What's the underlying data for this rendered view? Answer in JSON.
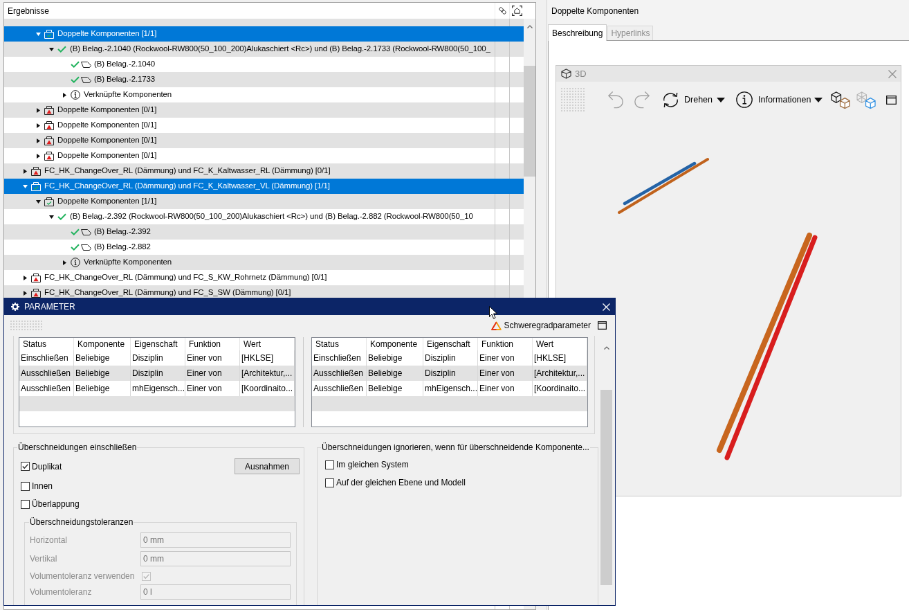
{
  "results_panel": {
    "title": "Ergebnisse",
    "tree": [
      {
        "children": [
          {
            "kind": "group",
            "resolved": true,
            "label": "Doppelte Komponenten [1/1]",
            "selected": true,
            "expanded": true,
            "children": [
              {
                "kind": "pair",
                "label": "(B) Belag.-2.1040 (Rockwool-RW800(50_100_200)Alukaschiert <Rc>) und (B) Belag.-2.1733 (Rockwool-RW800(50_100_",
                "selected": false,
                "expanded": true,
                "children": [
                  {
                    "kind": "component",
                    "label": "(B) Belag.-2.1040",
                    "selected": false
                  },
                  {
                    "kind": "component",
                    "label": "(B) Belag.-2.1733",
                    "selected": false
                  },
                  {
                    "kind": "related",
                    "label": "Verknüpfte Komponenten",
                    "selected": false,
                    "expanded": false
                  }
                ]
              }
            ]
          },
          {
            "kind": "group",
            "resolved": false,
            "label": "Doppelte Komponenten [0/1]",
            "selected": false,
            "expanded": false
          },
          {
            "kind": "group",
            "resolved": false,
            "label": "Doppelte Komponenten [0/1]",
            "selected": false,
            "expanded": false
          },
          {
            "kind": "group",
            "resolved": false,
            "label": "Doppelte Komponenten [0/1]",
            "selected": false,
            "expanded": false
          },
          {
            "kind": "group",
            "resolved": false,
            "label": "Doppelte Komponenten [0/1]",
            "selected": false,
            "expanded": false
          }
        ]
      },
      {
        "kind": "group",
        "resolved": false,
        "label": "FC_HK_ChangeOver_RL (Dämmung) und FC_K_Kaltwasser_RL (Dämmung) [0/1]",
        "selected": false,
        "expanded": false
      },
      {
        "kind": "group",
        "resolved": true,
        "label": "FC_HK_ChangeOver_RL (Dämmung) und FC_K_Kaltwasser_VL (Dämmung) [1/1]",
        "selected": true,
        "expanded": true,
        "children": [
          {
            "kind": "group",
            "resolved": true,
            "label": "Doppelte Komponenten [1/1]",
            "selected": false,
            "expanded": true,
            "children": [
              {
                "kind": "pair",
                "label": "(B) Belag.-2.392 (Rockwool-RW800(50_100_200)Alukaschiert <Rc>) und (B) Belag.-2.882 (Rockwool-RW800(50_10",
                "selected": false,
                "expanded": true,
                "children": [
                  {
                    "kind": "component",
                    "label": "(B) Belag.-2.392",
                    "selected": false
                  },
                  {
                    "kind": "component",
                    "label": "(B) Belag.-2.882",
                    "selected": false
                  },
                  {
                    "kind": "related",
                    "label": "Verknüpfte Komponenten",
                    "selected": false,
                    "expanded": false
                  }
                ]
              }
            ]
          }
        ]
      },
      {
        "kind": "group",
        "resolved": false,
        "label": "FC_HK_ChangeOver_RL (Dämmung) und FC_S_KW_Rohrnetz (Dämmung) [0/1]",
        "selected": false,
        "expanded": false
      },
      {
        "kind": "group",
        "resolved": false,
        "label": "FC_HK_ChangeOver_RL (Dämmung) und FC_S_SW (Dämmung) [0/1]",
        "selected": false,
        "expanded": false
      }
    ]
  },
  "details_panel": {
    "title": "Doppelte Komponenten",
    "tabs": [
      {
        "label": "Beschreibung",
        "selected": true
      },
      {
        "label": "Hyperlinks",
        "selected": false
      }
    ],
    "viewer": {
      "title": "3D",
      "toolbar": [
        {
          "kind": "undo",
          "disabled": true
        },
        {
          "kind": "redo",
          "disabled": true
        },
        {
          "kind": "rotate",
          "label": "Drehen",
          "dropdown": true
        },
        {
          "kind": "info",
          "label": "Informationen",
          "dropdown": true
        },
        {
          "kind": "cubes"
        },
        {
          "kind": "cubes-wireframe"
        },
        {
          "kind": "window"
        }
      ]
    }
  },
  "parameter_dialog": {
    "title": "PARAMETER",
    "severity_button": "Schweregradparameter",
    "rule_tables": [
      {
        "columns": [
          "Status",
          "Komponente",
          "Eigenschaft",
          "Funktion",
          "Wert"
        ],
        "rows": [
          [
            "Einschließen",
            "Beliebige",
            "Disziplin",
            "Einer von",
            "[HKLSE]"
          ],
          [
            "Ausschließen",
            "Beliebige",
            "Disziplin",
            "Einer von",
            "[Architektur,..."
          ],
          [
            "Ausschließen",
            "Beliebige",
            "mhEigensch...",
            "Einer von",
            "[Koordinaito..."
          ]
        ]
      },
      {
        "columns": [
          "Status",
          "Komponente",
          "Eigenschaft",
          "Funktion",
          "Wert"
        ],
        "rows": [
          [
            "Einschließen",
            "Beliebige",
            "Disziplin",
            "Einer von",
            "[HKLSE]"
          ],
          [
            "Ausschließen",
            "Beliebige",
            "Disziplin",
            "Einer von",
            "[Architektur,..."
          ],
          [
            "Ausschließen",
            "Beliebige",
            "mhEigensch...",
            "Einer von",
            "[Koordinaito..."
          ]
        ]
      }
    ],
    "include_group": {
      "title": "Überschneidungen einschließen",
      "options": [
        {
          "label": "Duplikat",
          "checked": true
        },
        {
          "label": "Innen",
          "checked": false
        },
        {
          "label": "Überlappung",
          "checked": false
        }
      ],
      "exceptions_button": "Ausnahmen",
      "tolerances": {
        "title": "Überschneidungstoleranzen",
        "fields": [
          {
            "kind": "input",
            "label": "Horizontal",
            "value": "0 mm",
            "disabled": true
          },
          {
            "kind": "input",
            "label": "Vertikal",
            "value": "0 mm",
            "disabled": true
          },
          {
            "kind": "checkbox",
            "label": "Volumentoleranz verwenden",
            "checked": true,
            "disabled": true
          },
          {
            "kind": "input",
            "label": "Volumentoleranz",
            "value": "0 l",
            "disabled": true
          }
        ]
      }
    },
    "ignore_group": {
      "title": "Überschneidungen ignorieren, wenn für überschneidende Komponente...",
      "options": [
        {
          "label": "Im gleichen System",
          "checked": false
        },
        {
          "label": "Auf der gleichen Ebene und Modell",
          "checked": false
        }
      ]
    }
  }
}
